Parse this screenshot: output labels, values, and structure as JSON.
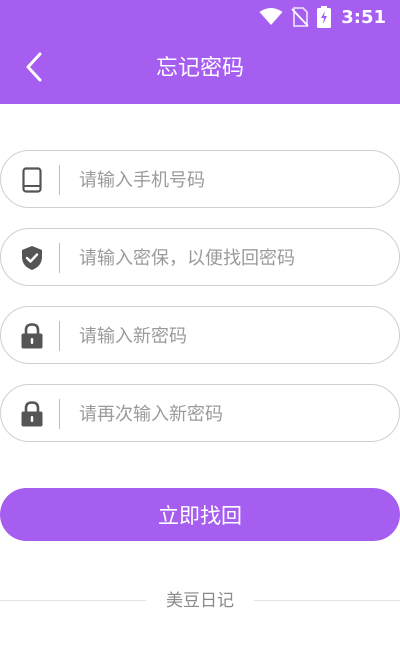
{
  "status_bar": {
    "time": "3:51",
    "icons": [
      "wifi-icon",
      "no-sim-icon",
      "battery-charging-icon"
    ]
  },
  "header": {
    "back_icon": "chevron-left-icon",
    "title": "忘记密码"
  },
  "form": {
    "phone": {
      "icon": "phone-icon",
      "placeholder": "请输入手机号码",
      "value": ""
    },
    "security": {
      "icon": "shield-check-icon",
      "placeholder": "请输入密保，以便找回密码",
      "value": ""
    },
    "new_password": {
      "icon": "lock-icon",
      "placeholder": "请输入新密码",
      "value": ""
    },
    "confirm_password": {
      "icon": "lock-icon",
      "placeholder": "请再次输入新密码",
      "value": ""
    }
  },
  "submit_label": "立即找回",
  "footer": {
    "text": "美豆日记"
  },
  "colors": {
    "accent": "#a55ef0",
    "icon": "#555555",
    "placeholder": "#9a9a9a",
    "border": "#cfcfcf"
  }
}
